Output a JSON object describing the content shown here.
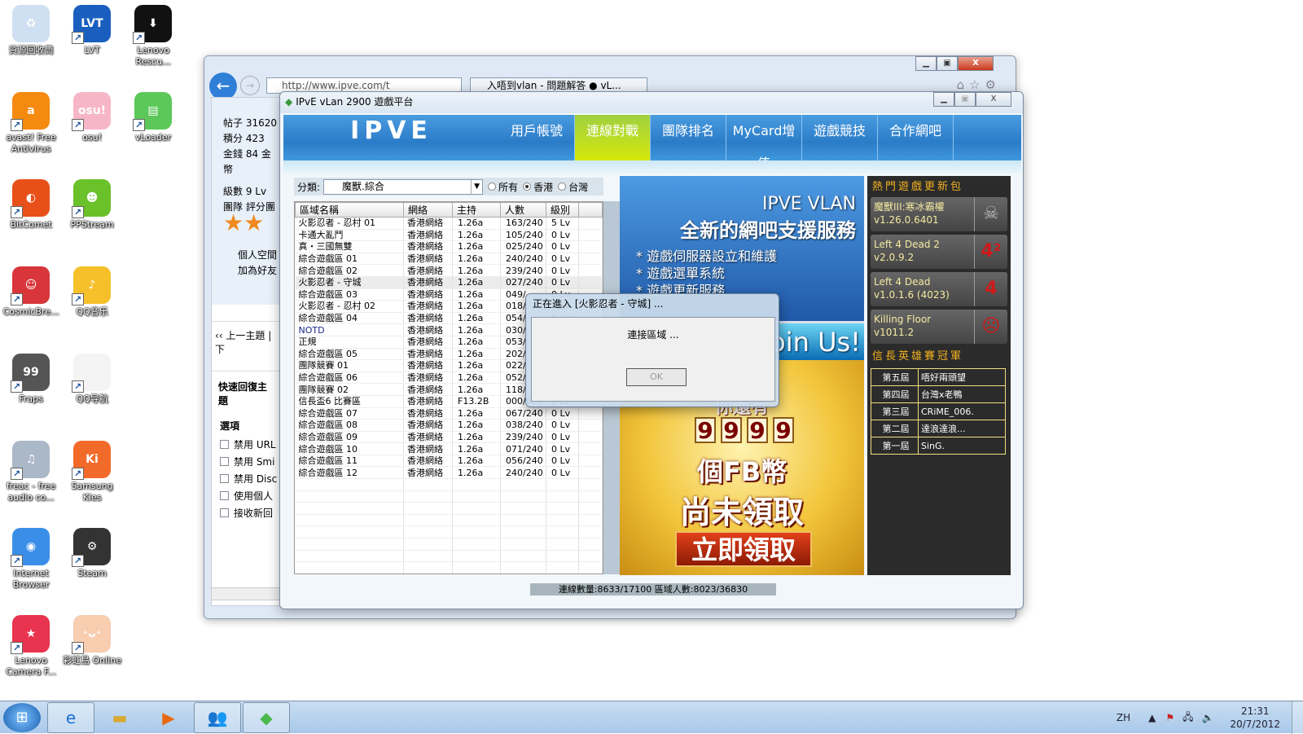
{
  "desktop": {
    "icons": [
      {
        "label": "資源回收筒",
        "icon": "recycle-bin-icon",
        "color": "#cfe0f2",
        "glyph": "♻"
      },
      {
        "label": "LVT",
        "icon": "lvt-icon",
        "color": "#1a5fbf",
        "glyph": "LVT"
      },
      {
        "label": "Lenovo Rescu...",
        "icon": "lenovo-rescue-icon",
        "color": "#111",
        "glyph": "⬇"
      },
      {
        "label": "avast! Free Antivirus",
        "icon": "avast-icon",
        "color": "#f58a10",
        "glyph": "a"
      },
      {
        "label": "osu!",
        "icon": "osu-icon",
        "color": "#f7b6c8",
        "glyph": "osu!"
      },
      {
        "label": "vLoader",
        "icon": "vloader-icon",
        "color": "#5cc85a",
        "glyph": "▤"
      },
      {
        "label": "BitComet",
        "icon": "bitcomet-icon",
        "color": "#e8501a",
        "glyph": "◐"
      },
      {
        "label": "PPStream",
        "icon": "ppstream-icon",
        "color": "#6ac12a",
        "glyph": "☻"
      },
      {
        "label": "CosmicBre...",
        "icon": "cosmic-break-icon",
        "color": "#d8363a",
        "glyph": "☺"
      },
      {
        "label": "QQ音乐",
        "icon": "qq-music-icon",
        "color": "#f5c02a",
        "glyph": "♪"
      },
      {
        "label": "Fraps",
        "icon": "fraps-icon",
        "color": "#555",
        "glyph": "99"
      },
      {
        "label": "QQ导航",
        "icon": "qq-nav-icon",
        "color": "#f4f4f4",
        "glyph": ""
      },
      {
        "label": "freac - free audio co...",
        "icon": "freac-icon",
        "color": "#aab8c8",
        "glyph": "♫"
      },
      {
        "label": "Samsung Kies",
        "icon": "samsung-kies-icon",
        "color": "#f26a2a",
        "glyph": "Ki"
      },
      {
        "label": "Internet Browser",
        "icon": "chrome-icon",
        "color": "#3a8ee8",
        "glyph": "◉"
      },
      {
        "label": "Steam",
        "icon": "steam-icon",
        "color": "#333",
        "glyph": "⚙"
      },
      {
        "label": "Lenovo Camera F...",
        "icon": "lenovo-camera-icon",
        "color": "#e8344e",
        "glyph": "★"
      },
      {
        "label": "彩虹島 Online",
        "icon": "rainbow-island-icon",
        "color": "#f8cdb0",
        "glyph": "･ᴗ･"
      }
    ]
  },
  "browser": {
    "url": "http://www.ipve.com/t",
    "tab_title": "入唔到vlan - 問題解答 ● vL...",
    "profile": {
      "lines": [
        "帖子  31620",
        "積分  423",
        "金錢  84 金幣",
        "",
        "級數  9 Lv",
        "團隊  評分團"
      ],
      "links": [
        "個人空間",
        "加為好友"
      ]
    },
    "nav": "‹‹ 上一主題 | 下",
    "quick_reply": "快速回復主題",
    "options": "選項",
    "checkboxes": [
      "禁用 URL",
      "禁用 Smi",
      "禁用 Disc",
      "使用個人",
      "接收新回"
    ]
  },
  "app": {
    "title": "IPvE vLan 2900 遊戲平台",
    "logo": "IPVE",
    "nav": [
      "用戶帳號",
      "連線對戰",
      "團隊排名",
      "MyCard增值",
      "遊戲競技",
      "合作網吧"
    ],
    "active_nav": 1,
    "category": {
      "label": "分類:",
      "value": "魔獸.綜合",
      "radios": [
        {
          "label": "所有",
          "checked": false
        },
        {
          "label": "香港",
          "checked": true
        },
        {
          "label": "台灣",
          "checked": false
        }
      ]
    },
    "table": {
      "headers": [
        "區域名稱",
        "網絡",
        "主持",
        "人數",
        "級別"
      ],
      "rows": [
        [
          "火影忍者 - 忍村 01",
          "香港網絡",
          "1.26a",
          "163/240",
          "5 Lv"
        ],
        [
          "卡通大亂鬥",
          "香港網絡",
          "1.26a",
          "105/240",
          "0 Lv"
        ],
        [
          "真・三國無雙",
          "香港網絡",
          "1.26a",
          "025/240",
          "0 Lv"
        ],
        [
          "綜合遊戲區 01",
          "香港網絡",
          "1.26a",
          "240/240",
          "0 Lv"
        ],
        [
          "綜合遊戲區 02",
          "香港網絡",
          "1.26a",
          "239/240",
          "0 Lv"
        ],
        [
          "火影忍者 - 守城",
          "香港網絡",
          "1.26a",
          "027/240",
          "0 Lv"
        ],
        [
          "綜合遊戲區 03",
          "香港網絡",
          "1.26a",
          "049/",
          "0 Lv"
        ],
        [
          "火影忍者 - 忍村 02",
          "香港網絡",
          "1.26a",
          "018/",
          "0 Lv"
        ],
        [
          "綜合遊戲區 04",
          "香港網絡",
          "1.26a",
          "054/",
          "0 Lv"
        ],
        [
          "NOTD",
          "香港網絡",
          "1.26a",
          "030/",
          "0 Lv"
        ],
        [
          "正規",
          "香港網絡",
          "1.26a",
          "053/",
          "0 Lv"
        ],
        [
          "綜合遊戲區 05",
          "香港網絡",
          "1.26a",
          "202/",
          "0 Lv"
        ],
        [
          "團隊競賽 01",
          "香港網絡",
          "1.26a",
          "022/",
          "0 Lv"
        ],
        [
          "綜合遊戲區 06",
          "香港網絡",
          "1.26a",
          "052/",
          "0 Lv"
        ],
        [
          "團隊競賽 02",
          "香港網絡",
          "1.26a",
          "118/",
          "0 Lv"
        ],
        [
          "信長盃6 比賽區",
          "香港網絡",
          "F13.2B",
          "000/000",
          "0 Lv"
        ],
        [
          "綜合遊戲區 07",
          "香港網絡",
          "1.26a",
          "067/240",
          "0 Lv"
        ],
        [
          "綜合遊戲區 08",
          "香港網絡",
          "1.26a",
          "038/240",
          "0 Lv"
        ],
        [
          "綜合遊戲區 09",
          "香港網絡",
          "1.26a",
          "239/240",
          "0 Lv"
        ],
        [
          "綜合遊戲區 10",
          "香港網絡",
          "1.26a",
          "071/240",
          "0 Lv"
        ],
        [
          "綜合遊戲區 11",
          "香港網絡",
          "1.26a",
          "056/240",
          "0 Lv"
        ],
        [
          "綜合遊戲區 12",
          "香港網絡",
          "1.26a",
          "240/240",
          "0 Lv"
        ]
      ],
      "selected_row": 5
    },
    "ad": {
      "en": "IPVE VLAN",
      "zh": "全新的網吧支援服務",
      "bullets": [
        "遊戲伺服器設立和維護",
        "遊戲選單系統",
        "遊戲更新服務"
      ],
      "join": "Join Us!",
      "promo_top": "你還有",
      "digits": [
        "9",
        "9",
        "9",
        "9"
      ],
      "promo_unit": "個FB幣",
      "promo_line": "尚未領取",
      "promo_button": "立即領取"
    },
    "updates": {
      "title": "熱門遊戲更新包",
      "items": [
        {
          "name": "魔獸III:寒冰霸權",
          "version": "v1.26.0.6401",
          "icon": "warcraft3-icon"
        },
        {
          "name": "Left 4 Dead 2",
          "version": "v2.0.9.2",
          "icon": "l4d2-icon"
        },
        {
          "name": "Left 4 Dead",
          "version": "v1.0.1.6 (4023)",
          "icon": "l4d-icon"
        },
        {
          "name": "Killing Floor",
          "version": "v1011.2",
          "icon": "killing-floor-icon"
        }
      ]
    },
    "champions": {
      "title": "信長英雄賽冠軍",
      "rows": [
        [
          "第五屆",
          "唔好兩頭望"
        ],
        [
          "第四屆",
          "台灣x老鴨"
        ],
        [
          "第三屆",
          "CRiME_006."
        ],
        [
          "第二屆",
          "達浪達浪..."
        ],
        [
          "第一屆",
          "SinG."
        ]
      ]
    },
    "status": "連線數量:8633/17100    區域人數:8023/36830"
  },
  "dialog": {
    "title": "正在進入 [火影忍者 - 守城] ...",
    "message": "連接區域 ...",
    "ok": "OK"
  },
  "taskbar": {
    "lang": "ZH",
    "time": "21:31",
    "date": "20/7/2012"
  }
}
